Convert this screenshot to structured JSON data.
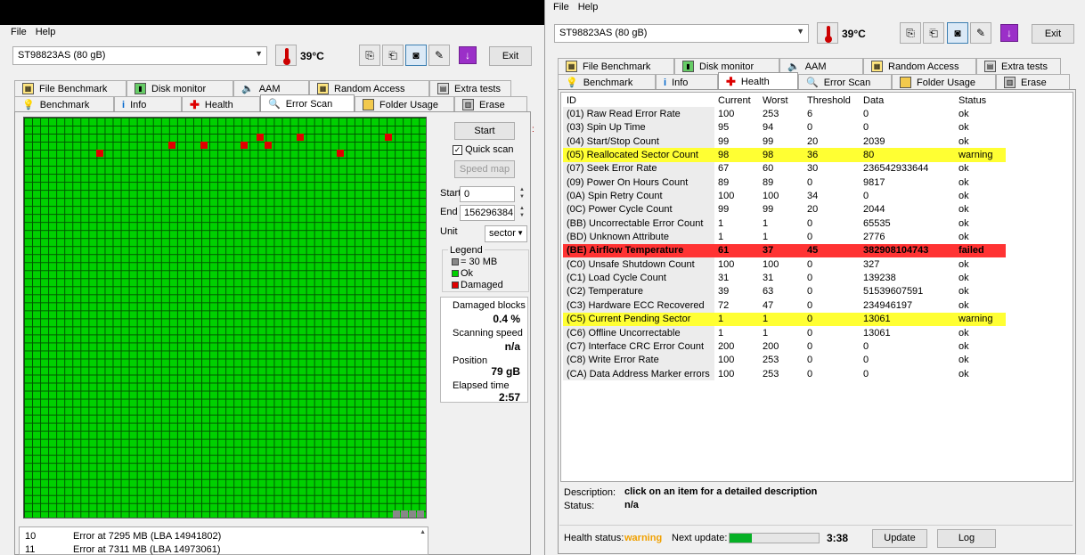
{
  "left_window": {
    "menu": [
      "File",
      "Help"
    ],
    "drive": "ST98823AS (80 gB)",
    "temperature": "39°C",
    "exit_label": "Exit",
    "tabs_top": [
      "File Benchmark",
      "Disk monitor",
      "AAM",
      "Random Access",
      "Extra tests"
    ],
    "tabs_bottom": [
      "Benchmark",
      "Info",
      "Health",
      "Error Scan",
      "Folder Usage",
      "Erase"
    ],
    "active_tab": "Error Scan",
    "start_label": "Start",
    "quick_scan_label": "Quick scan",
    "quick_scan_checked": true,
    "speed_map_label": "Speed map",
    "start_field_label": "Start",
    "start_value": "0",
    "end_field_label": "End",
    "end_value": "156296384",
    "unit_label": "Unit",
    "unit_value": "sector",
    "legend": {
      "title": "Legend",
      "block": "= 30 MB",
      "ok": "Ok",
      "damaged": "Damaged"
    },
    "stats": {
      "damaged_blocks_label": "Damaged blocks",
      "damaged_blocks_value": "0.4 %",
      "scanning_speed_label": "Scanning speed",
      "scanning_speed_value": "n/a",
      "position_label": "Position",
      "position_value": "79 gB",
      "elapsed_label": "Elapsed time",
      "elapsed_value": "2:57"
    },
    "log": [
      {
        "n": "10",
        "text": "Error at 7295 MB (LBA 14941802)"
      },
      {
        "n": "11",
        "text": "Error at 7311 MB (LBA 14973061)"
      }
    ]
  },
  "right_window": {
    "menu": [
      "File",
      "Help"
    ],
    "drive": "ST98823AS (80 gB)",
    "temperature": "39°C",
    "exit_label": "Exit",
    "tabs_top": [
      "File Benchmark",
      "Disk monitor",
      "AAM",
      "Random Access",
      "Extra tests"
    ],
    "tabs_bottom": [
      "Benchmark",
      "Info",
      "Health",
      "Error Scan",
      "Folder Usage",
      "Erase"
    ],
    "active_tab": "Health",
    "columns": [
      "ID",
      "Current",
      "Worst",
      "Threshold",
      "Data",
      "Status"
    ],
    "rows": [
      {
        "id": "(01) Raw Read Error Rate",
        "current": "100",
        "worst": "253",
        "threshold": "6",
        "data": "0",
        "status": "ok"
      },
      {
        "id": "(03) Spin Up Time",
        "current": "95",
        "worst": "94",
        "threshold": "0",
        "data": "0",
        "status": "ok"
      },
      {
        "id": "(04) Start/Stop Count",
        "current": "99",
        "worst": "99",
        "threshold": "20",
        "data": "2039",
        "status": "ok"
      },
      {
        "id": "(05) Reallocated Sector Count",
        "current": "98",
        "worst": "98",
        "threshold": "36",
        "data": "80",
        "status": "warning"
      },
      {
        "id": "(07) Seek Error Rate",
        "current": "67",
        "worst": "60",
        "threshold": "30",
        "data": "236542933644",
        "status": "ok"
      },
      {
        "id": "(09) Power On Hours Count",
        "current": "89",
        "worst": "89",
        "threshold": "0",
        "data": "9817",
        "status": "ok"
      },
      {
        "id": "(0A) Spin Retry Count",
        "current": "100",
        "worst": "100",
        "threshold": "34",
        "data": "0",
        "status": "ok"
      },
      {
        "id": "(0C) Power Cycle Count",
        "current": "99",
        "worst": "99",
        "threshold": "20",
        "data": "2044",
        "status": "ok"
      },
      {
        "id": "(BB) Uncorrectable Error Count",
        "current": "1",
        "worst": "1",
        "threshold": "0",
        "data": "65535",
        "status": "ok"
      },
      {
        "id": "(BD) Unknown Attribute",
        "current": "1",
        "worst": "1",
        "threshold": "0",
        "data": "2776",
        "status": "ok"
      },
      {
        "id": "(BE) Airflow Temperature",
        "current": "61",
        "worst": "37",
        "threshold": "45",
        "data": "382908104743",
        "status": "failed"
      },
      {
        "id": "(C0) Unsafe Shutdown Count",
        "current": "100",
        "worst": "100",
        "threshold": "0",
        "data": "327",
        "status": "ok"
      },
      {
        "id": "(C1) Load Cycle Count",
        "current": "31",
        "worst": "31",
        "threshold": "0",
        "data": "139238",
        "status": "ok"
      },
      {
        "id": "(C2) Temperature",
        "current": "39",
        "worst": "63",
        "threshold": "0",
        "data": "51539607591",
        "status": "ok"
      },
      {
        "id": "(C3) Hardware ECC Recovered",
        "current": "72",
        "worst": "47",
        "threshold": "0",
        "data": "234946197",
        "status": "ok"
      },
      {
        "id": "(C5) Current Pending Sector",
        "current": "1",
        "worst": "1",
        "threshold": "0",
        "data": "13061",
        "status": "warning"
      },
      {
        "id": "(C6) Offline Uncorrectable",
        "current": "1",
        "worst": "1",
        "threshold": "0",
        "data": "13061",
        "status": "ok"
      },
      {
        "id": "(C7) Interface CRC Error Count",
        "current": "200",
        "worst": "200",
        "threshold": "0",
        "data": "0",
        "status": "ok"
      },
      {
        "id": "(C8) Write Error Rate",
        "current": "100",
        "worst": "253",
        "threshold": "0",
        "data": "0",
        "status": "ok"
      },
      {
        "id": "(CA) Data Address Marker errors",
        "current": "100",
        "worst": "253",
        "threshold": "0",
        "data": "0",
        "status": "ok"
      }
    ],
    "description_label": "Description:",
    "description_value": "click on an item for a detailed description",
    "status_label": "Status:",
    "status_value": "n/a",
    "health_status_label": "Health status:",
    "health_status_value": "warning",
    "next_update_label": "Next update:",
    "next_update_progress": 0.25,
    "next_update_time": "3:38",
    "update_label": "Update",
    "log_label": "Log",
    "colors": {
      "warning_row": "#ffff33",
      "failed_row": "#ff3333",
      "health_warning_text": "#f0a000"
    }
  }
}
